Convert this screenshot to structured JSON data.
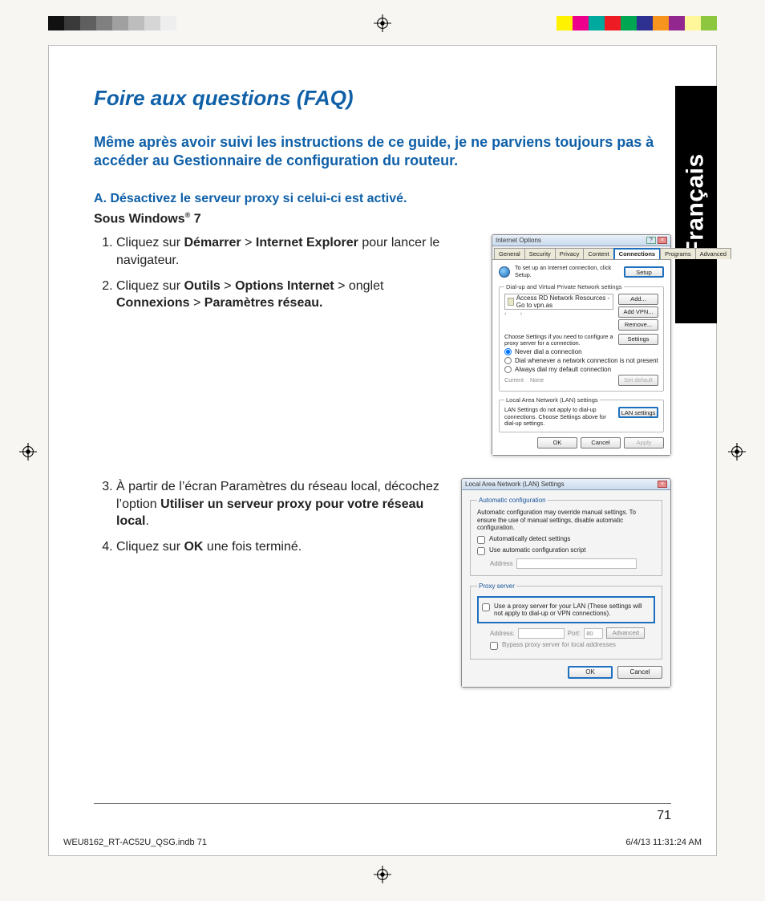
{
  "colorbars": {
    "left": [
      "#111",
      "#3a3a3a",
      "#5f5f5f",
      "#808080",
      "#a0a0a0",
      "#bdbdbd",
      "#d6d6d6",
      "#eeeeee"
    ],
    "right": [
      "#fff200",
      "#ec008c",
      "#00a99d",
      "#ed1c24",
      "#00a651",
      "#2e3192",
      "#f7941d",
      "#92278f",
      "#fff799",
      "#8dc63f"
    ]
  },
  "language_tab": "Français",
  "title": "Foire aux questions (FAQ)",
  "intro": "Même après avoir suivi les instructions de ce guide, je ne parviens toujours pas à accéder au Gestionnaire de configuration du routeur.",
  "sectionA": "A.   Désactivez le serveur proxy si celui-ci est activé.",
  "os_line": {
    "prefix": "Sous Windows",
    "reg": "®",
    "suffix": " 7"
  },
  "steps_top": [
    {
      "parts": [
        "Cliquez sur ",
        {
          "b": "Démarrer"
        },
        " > ",
        {
          "b": "Internet Explorer"
        },
        " pour lancer le navigateur."
      ]
    },
    {
      "parts": [
        "Cliquez sur ",
        {
          "b": "Outils"
        },
        " > ",
        {
          "b": "Options Internet"
        },
        " > onglet ",
        {
          "b": "Connexions"
        },
        " > ",
        {
          "b": "Paramètres réseau."
        }
      ]
    }
  ],
  "steps_bottom": [
    {
      "parts": [
        "À partir de l’écran Paramètres du réseau local, décochez l’option ",
        {
          "b": "Utiliser un serveur proxy pour votre réseau local"
        },
        "."
      ]
    },
    {
      "parts": [
        "Cliquez sur ",
        {
          "b": "OK"
        },
        " une fois terminé."
      ]
    }
  ],
  "io_dialog": {
    "title": "Internet Options",
    "tabs": [
      "General",
      "Security",
      "Privacy",
      "Content",
      "Connections",
      "Programs",
      "Advanced"
    ],
    "active_tab": "Connections",
    "setup_text": "To set up an Internet connection, click Setup.",
    "setup_btn": "Setup",
    "dial_legend": "Dial-up and Virtual Private Network settings",
    "dial_item": "Access RD Network Resources - Go to vpn.as",
    "btn_add": "Add...",
    "btn_addvpn": "Add VPN...",
    "btn_remove": "Remove...",
    "proxy_note": "Choose Settings if you need to configure a proxy server for a connection.",
    "btn_settings": "Settings",
    "radio1": "Never dial a connection",
    "radio2": "Dial whenever a network connection is not present",
    "radio3": "Always dial my default connection",
    "current_lbl": "Current",
    "current_val": "None",
    "btn_setdefault": "Set default",
    "lan_legend": "Local Area Network (LAN) settings",
    "lan_text": "LAN Settings do not apply to dial-up connections. Choose Settings above for dial-up settings.",
    "btn_lan": "LAN settings",
    "btn_ok": "OK",
    "btn_cancel": "Cancel",
    "btn_apply": "Apply"
  },
  "lan_dialog": {
    "title": "Local Area Network (LAN) Settings",
    "auto_legend": "Automatic configuration",
    "auto_note": "Automatic configuration may override manual settings. To ensure the use of manual settings, disable automatic configuration.",
    "ck_auto_detect": "Automatically detect settings",
    "ck_auto_script": "Use automatic configuration script",
    "addr_lbl": "Address",
    "proxy_legend": "Proxy server",
    "ck_proxy": "Use a proxy server for your LAN (These settings will not apply to dial-up or VPN connections).",
    "addr2_lbl": "Address:",
    "port_lbl": "Port:",
    "port_val": "80",
    "btn_adv": "Advanced",
    "ck_bypass": "Bypass proxy server for local addresses",
    "btn_ok": "OK",
    "btn_cancel": "Cancel"
  },
  "page_number": "71",
  "print_footer": {
    "left": "WEU8162_RT-AC52U_QSG.indb   71",
    "right": "6/4/13   11:31:24 AM"
  }
}
